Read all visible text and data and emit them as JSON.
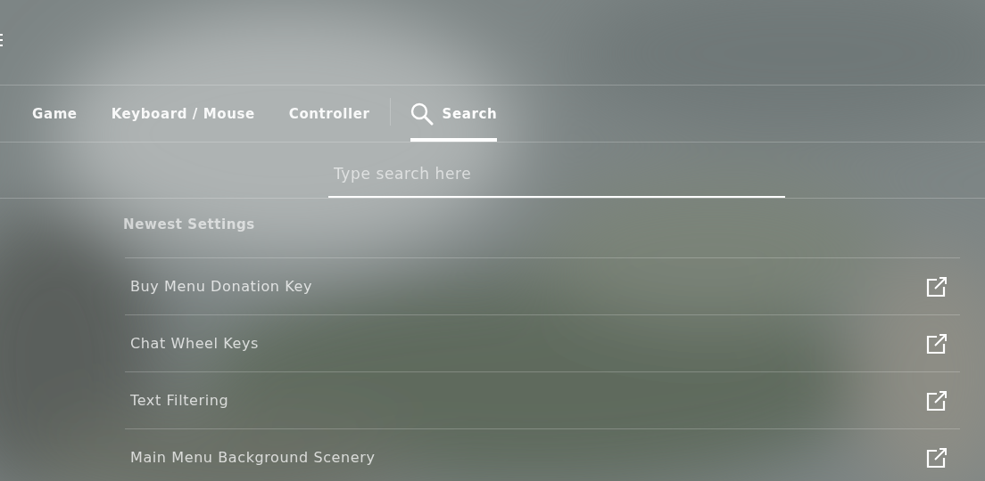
{
  "tabs": [
    {
      "label": "Game",
      "kind": "text",
      "selected": false
    },
    {
      "label": "Keyboard / Mouse",
      "kind": "text",
      "selected": false
    },
    {
      "label": "Controller",
      "kind": "text",
      "selected": false
    },
    {
      "label": "Search",
      "kind": "search",
      "selected": true
    }
  ],
  "search": {
    "placeholder": "Type search here"
  },
  "section": {
    "title": "Newest Settings"
  },
  "settings": [
    {
      "label": "Buy Menu Donation Key"
    },
    {
      "label": "Chat Wheel Keys"
    },
    {
      "label": "Text Filtering"
    },
    {
      "label": "Main Menu Background Scenery"
    }
  ]
}
